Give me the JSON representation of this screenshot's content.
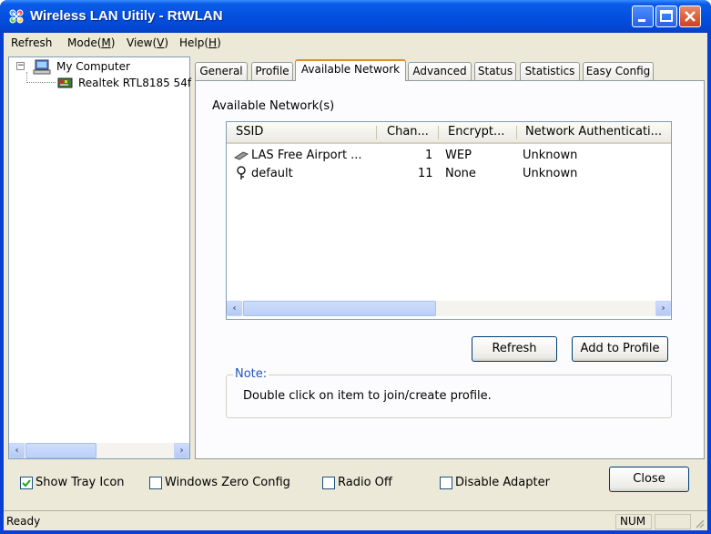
{
  "window": {
    "title": "Wireless LAN Uitily - RtWLAN"
  },
  "menu": {
    "items": [
      {
        "label": "Refresh"
      },
      {
        "label": "Mode(",
        "mnemonic": "M",
        "suffix": ")"
      },
      {
        "label": "View(",
        "mnemonic": "V",
        "suffix": ")"
      },
      {
        "label": "Help(",
        "mnemonic": "H",
        "suffix": ")"
      }
    ]
  },
  "tree": {
    "root": "My Computer",
    "child": "Realtek RTL8185 54f"
  },
  "tabs": [
    "General",
    "Profile",
    "Available Network",
    "Advanced",
    "Status",
    "Statistics",
    "Easy Config"
  ],
  "active_tab": "Available Network",
  "available": {
    "heading": "Available Network(s)",
    "columns": [
      "SSID",
      "Chan...",
      "Encrypt...",
      "Network Authenticati..."
    ],
    "rows": [
      {
        "ssid": "LAS Free Airport ...",
        "channel": "1",
        "encryption": "WEP",
        "auth": "Unknown",
        "icon": "ap-antenna-icon"
      },
      {
        "ssid": "default",
        "channel": "11",
        "encryption": "None",
        "auth": "Unknown",
        "icon": "adhoc-key-icon"
      }
    ],
    "refresh_button": "Refresh",
    "add_profile_button": "Add to Profile",
    "note_title": "Note:",
    "note_text": "Double click on item to join/create profile."
  },
  "options": {
    "show_tray_icon": {
      "label": "Show Tray Icon",
      "checked": true
    },
    "windows_zero_config": {
      "label": "Windows Zero Config",
      "checked": false
    },
    "radio_off": {
      "label": "Radio Off",
      "checked": false
    },
    "disable_adapter": {
      "label": "Disable Adapter",
      "checked": false
    },
    "close_button": "Close"
  },
  "status": {
    "text": "Ready",
    "num": "NUM"
  },
  "colors": {
    "titlebar": "#0550e0",
    "tab_highlight": "#e68b2c",
    "note_title": "#2055c0",
    "check": "#21a121"
  }
}
